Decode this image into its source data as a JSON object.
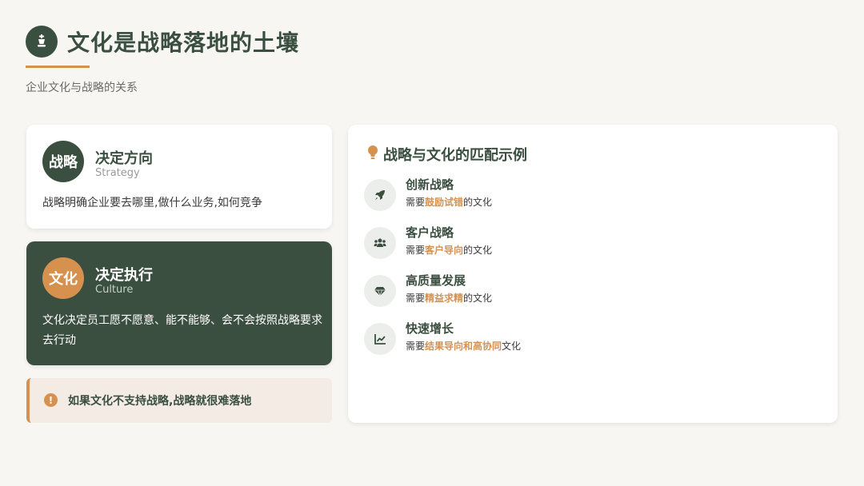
{
  "header": {
    "title": "文化是战略落地的土壤",
    "subtitle": "企业文化与战略的关系",
    "icon": "chess-icon"
  },
  "strategy_card": {
    "badge": "战略",
    "heading": "决定方向",
    "heading_en": "Strategy",
    "body": "战略明确企业要去哪里,做什么业务,如何竞争"
  },
  "culture_card": {
    "badge": "文化",
    "heading": "决定执行",
    "heading_en": "Culture",
    "body": "文化决定员工愿不愿意、能不能够、会不会按照战略要求去行动"
  },
  "warning": {
    "icon": "exclamation-icon",
    "text": "如果文化不支持战略,战略就很难落地"
  },
  "examples": {
    "title": "战略与文化的匹配示例",
    "items": [
      {
        "title": "创新战略",
        "prefix": "需要",
        "highlight": "鼓励试错",
        "suffix": "的文化",
        "icon": "rocket-icon"
      },
      {
        "title": "客户战略",
        "prefix": "需要",
        "highlight": "客户导向",
        "suffix": "的文化",
        "icon": "users-icon"
      },
      {
        "title": "高质量发展",
        "prefix": "需要",
        "highlight": "精益求精",
        "suffix": "的文化",
        "icon": "gem-icon"
      },
      {
        "title": "快速增长",
        "prefix": "需要",
        "highlight": "结果导向和高协同",
        "suffix": "文化",
        "icon": "chart-line-icon"
      }
    ]
  },
  "colors": {
    "primary": "#3b4f40",
    "accent": "#d6914f",
    "background": "#f7f6f3"
  }
}
